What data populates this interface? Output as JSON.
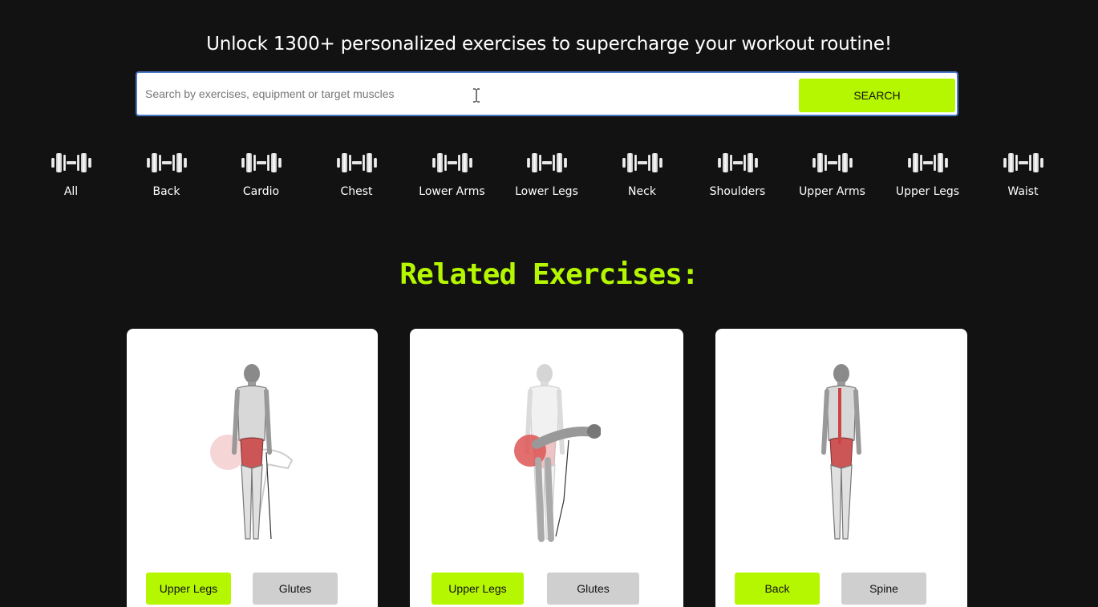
{
  "hero": {
    "title": "Unlock 1300+ personalized exercises to supercharge your workout routine!"
  },
  "search": {
    "placeholder": "Search by exercises, equipment or target muscles",
    "value": "",
    "button_label": "SEARCH"
  },
  "categories": [
    {
      "label": "All",
      "icon": "dumbbell-icon"
    },
    {
      "label": "Back",
      "icon": "dumbbell-icon"
    },
    {
      "label": "Cardio",
      "icon": "dumbbell-icon"
    },
    {
      "label": "Chest",
      "icon": "dumbbell-icon"
    },
    {
      "label": "Lower Arms",
      "icon": "dumbbell-icon"
    },
    {
      "label": "Lower Legs",
      "icon": "dumbbell-icon"
    },
    {
      "label": "Neck",
      "icon": "dumbbell-icon"
    },
    {
      "label": "Shoulders",
      "icon": "dumbbell-icon"
    },
    {
      "label": "Upper Arms",
      "icon": "dumbbell-icon"
    },
    {
      "label": "Upper Legs",
      "icon": "dumbbell-icon"
    },
    {
      "label": "Waist",
      "icon": "dumbbell-icon"
    }
  ],
  "related": {
    "title": "Related Exercises:",
    "cards": [
      {
        "image": "exercise-illustration-glute-kickback",
        "primary_tag": "Upper Legs",
        "secondary_tag": "Glutes"
      },
      {
        "image": "exercise-illustration-pull-through",
        "primary_tag": "Upper Legs",
        "secondary_tag": "Glutes"
      },
      {
        "image": "exercise-illustration-back-extension",
        "primary_tag": "Back",
        "secondary_tag": "Spine"
      }
    ]
  },
  "colors": {
    "background": "#121212",
    "accent": "#b5f700",
    "secondary_tag": "#cfcfcf",
    "search_border": "#4a78c8"
  }
}
